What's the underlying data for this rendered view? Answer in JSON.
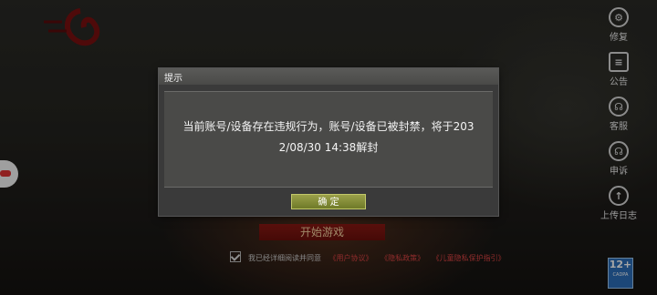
{
  "side_menu": [
    {
      "label": "修复",
      "icon": "wrench-gear-icon"
    },
    {
      "label": "公告",
      "icon": "notice-icon"
    },
    {
      "label": "客服",
      "icon": "headset-icon"
    },
    {
      "label": "申诉",
      "icon": "appeal-headset-icon"
    },
    {
      "label": "上传日志",
      "icon": "upload-icon"
    }
  ],
  "start_button": "开始游戏",
  "agreement": {
    "text": "我已经详细阅读并同意",
    "links": [
      "《用户协议》",
      "《隐私政策》",
      "《儿童隐私保护指引》"
    ]
  },
  "dialog": {
    "title": "提示",
    "message_line1": "当前账号/设备存在违规行为，账号/设备已被封禁，将于203",
    "message_line2": "2/08/30 14:38解封",
    "ok_label": "确 定"
  },
  "age_rating": {
    "value": "12+",
    "caption": "CADPA"
  }
}
